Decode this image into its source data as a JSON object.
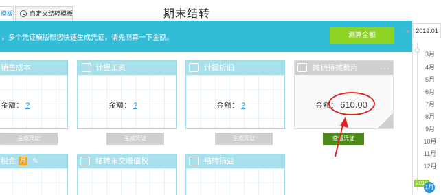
{
  "tabs": [
    {
      "label": "模板",
      "active": true
    },
    {
      "label": "自定义结转模板",
      "active": false
    }
  ],
  "page_title": "期末结转",
  "banner": {
    "text": "，多个凭证模版帮您快速生成凭证，请先测算一下金额。",
    "button_label": "测算全额"
  },
  "cards": [
    {
      "title": "销售成本",
      "amount_label": "金额：",
      "amount_value": "?",
      "button_label": "生成凭证"
    },
    {
      "title": "计提工资",
      "amount_label": "金额：",
      "amount_value": "?",
      "button_label": "生成凭证"
    },
    {
      "title": "计提折旧",
      "amount_label": "金额：",
      "amount_value": "?",
      "button_label": "生成凭证"
    },
    {
      "title": "摊销待摊费用",
      "amount_label": "金额：",
      "amount_value": "610.00",
      "button_label": "查看凭证",
      "more": "···"
    },
    {
      "title": "税金",
      "badge": "月"
    },
    {
      "title": "结转未交增值税"
    },
    {
      "title": "结转损益"
    }
  ],
  "sidebar": {
    "year_label": "2019.01",
    "arrow": "»",
    "months": [
      "3月",
      "4月",
      "5月",
      "6月",
      "7月",
      "8月",
      "9月",
      "10月",
      "11月",
      "12月"
    ],
    "current_year": "2019",
    "current_month": "1月"
  },
  "colors": {
    "banner": "#33bcd7",
    "calc_button": "#8dd321",
    "view_button": "#4e8a18",
    "card_header": "#a8e0ec",
    "annotation": "#e02424"
  }
}
